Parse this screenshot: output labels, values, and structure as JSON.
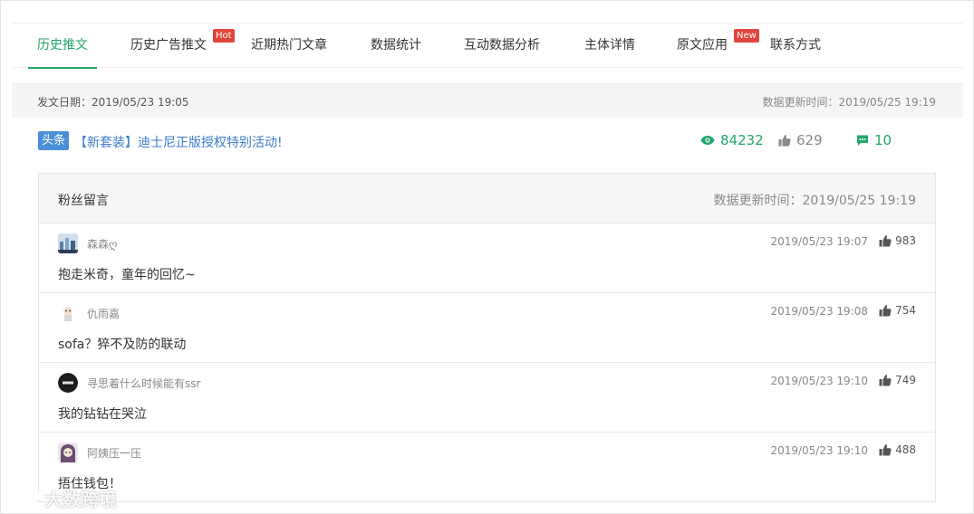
{
  "tabs": [
    {
      "label": "历史推文",
      "active": true
    },
    {
      "label": "历史广告推文",
      "badge": "Hot"
    },
    {
      "label": "近期热门文章"
    },
    {
      "label": "数据统计"
    },
    {
      "label": "互动数据分析"
    },
    {
      "label": "主体详情"
    },
    {
      "label": "原文应用",
      "badge": "New"
    },
    {
      "label": "联系方式"
    }
  ],
  "datebar": {
    "publish_label": "发文日期：2019/05/23 19:05",
    "update_label": "数据更新时间：2019/05/25 19:19"
  },
  "headline": {
    "tag": "头条",
    "title": "【新套装】迪士尼正版授权特别活动!",
    "views": "84232",
    "likes": "629",
    "comments": "10"
  },
  "comments_panel": {
    "title": "粉丝留言",
    "update_time": "数据更新时间：2019/05/25 19:19",
    "items": [
      {
        "name": "森森ღ",
        "time": "2019/05/23 19:07",
        "likes": "983",
        "text": "抱走米奇，童年的回忆~"
      },
      {
        "name": "仇雨嘉",
        "time": "2019/05/23 19:08",
        "likes": "754",
        "text": "sofa？猝不及防的联动"
      },
      {
        "name": "寻思着什么时候能有ssr",
        "time": "2019/05/23 19:10",
        "likes": "749",
        "text": "我的钻钻在哭泣"
      },
      {
        "name": "阿姨压一压",
        "time": "2019/05/23 19:10",
        "likes": "488",
        "text": "捂住钱包！"
      }
    ]
  },
  "watermark": "大数跨境",
  "colors": {
    "accent": "#22a56b",
    "link": "#3b7cc9",
    "badge": "#e0463d",
    "tag": "#4a8fd6"
  },
  "icons": {
    "views": "eye-icon",
    "likes": "thumbs-up-icon",
    "comments": "comment-icon"
  }
}
